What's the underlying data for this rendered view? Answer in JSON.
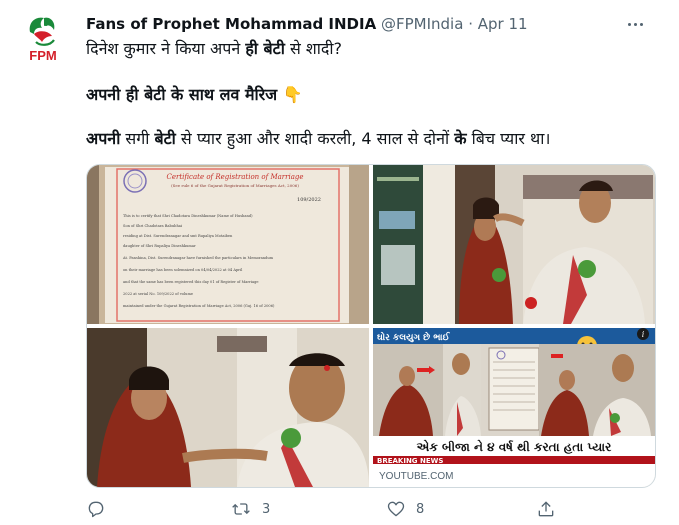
{
  "author": {
    "name": "Fans of Prophet Mohammad INDIA",
    "handle": "@FPMIndia",
    "separator": "·",
    "date": "Apr 11",
    "avatar_text": "FPM"
  },
  "tweet": {
    "line1_a": "दिनेश कुमार ने किया अपने ",
    "line1_b": "ही बेटी",
    "line1_c": " से शादी?",
    "line2": "अपनी ही बेटी के साथ लव मैरिज",
    "line2_emoji": "👇",
    "line3_a": "अपनी",
    "line3_b": " सगी ",
    "line3_c": "बेटी",
    "line3_d": " से प्यार हुआ और शादी करली, 4 साल से दोनों ",
    "line3_e": "के",
    "line3_f": " बिच प्यार था।"
  },
  "media": {
    "certificate": {
      "title": "Certificate of Registration of Marriage",
      "subtitle": "(See rule 6 of the Gujarat Registration of Marriages Act, 2006)",
      "number": "109/2022",
      "line1": "This is to certify that Shri   Chadotara Dineshkumar   (Name of Husband)",
      "line2": "Son of Shri   Chadotara Babubhai",
      "line3": "residing at   Dist. Surendranagar   and smt   Rupaliya Motaiben",
      "line4": "daughter of Shri   Rupaliya Dineshkumar",
      "line5": "At. Panshina, Dist. Surendranagar   have furnished the particulars in Memorandum",
      "line6": "on their marriage has been solemnized on   04/04/2022   at   04   April",
      "line7": "and that the same has been registered this day   01   of Register of Marriage",
      "line8": "2022   at serial No.   109/2022   of volume",
      "line9": "maintained under the Gujarat Registration of Marriage Act, 2006 (Guj. 16 of 2006)"
    },
    "news": {
      "banner_top": "ઘોર કલયુગ છે ભાઈ",
      "info_icon": "i",
      "caption": "એક બીજા ને ૪ વર્ષ થી કરતા હતા પ્યાર",
      "ticker": "BREAKING NEWS",
      "source": "YOUTUBE.COM"
    }
  },
  "actions": {
    "retweet_count": "3",
    "like_count": "8"
  },
  "colors": {
    "text": "#0f1419",
    "secondary": "#536471",
    "border": "#cfd9de",
    "logo_green": "#1a8a3a",
    "logo_red": "#d4202a"
  },
  "icons": [
    "more-icon",
    "reply-icon",
    "retweet-icon",
    "like-icon",
    "share-icon"
  ]
}
